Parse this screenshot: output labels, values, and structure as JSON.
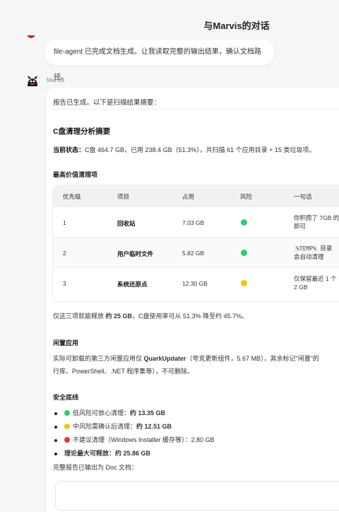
{
  "window": {
    "title": "与Marvis的对话"
  },
  "messages": {
    "first": "file-agent 已完成文档生成。让我读取完整的输出结果，确认文档路径。",
    "sender": "Marvis",
    "intro": "报告已生成。以下是扫描结果摘要："
  },
  "report": {
    "title": "C盘清理分析摘要",
    "status_label": "当前状态：",
    "status_text": "C盘 464.7 GB，已用 238.4 GB（51.3%），共扫描 61 个应用目录 + 15 类垃圾项。",
    "top_heading": "最高价值清理项",
    "table": {
      "headers": [
        "优先级",
        "项目",
        "占用",
        "风险",
        "一句话"
      ],
      "rows": [
        {
          "priority": "1",
          "item": "回收站",
          "size": "7.03 GB",
          "risk": "green",
          "line1": "你积攒了 7GB 的",
          "line2": "即可"
        },
        {
          "priority": "2",
          "item": "用户临时文件",
          "size": "5.82 GB",
          "risk": "green",
          "code": "%TEMP%",
          "line1_after": " 目录",
          "line2": "会自动清理"
        },
        {
          "priority": "3",
          "item": "系统还原点",
          "size": "12.30 GB",
          "risk": "yellow",
          "line1": "仅保留最近 1 个",
          "line2": "2 GB"
        }
      ]
    },
    "summary_pre": "仅这三项就能释放 ",
    "summary_bold": "约 25 GB",
    "summary_post": "，C盘使用率可从 51.3% 降至约 45.7%。",
    "idle_heading": "闲置应用",
    "idle_pre": "实际可卸载的第三方闲置应用仅 ",
    "idle_bold": "QuarkUpdater",
    "idle_post": "（夸克更新组件，5.67 MB），其余标记\"闲置\"的",
    "idle_line2": "行库、PowerShell、.NET 程序集等），不可删除。",
    "safety_heading": "安全底线",
    "bullets": [
      {
        "color": "green",
        "label": "低风险可放心清理：",
        "value": "约 13.35 GB"
      },
      {
        "color": "yellow",
        "label": "中风险需确认后清理：",
        "value": "约 12.51 GB"
      },
      {
        "color": "red",
        "label": "不建议清理（Windows Installer 缓存等）：2.80 GB",
        "value": ""
      },
      {
        "color": "",
        "label": "理论最大可释放：",
        "value": "约 25.86 GB"
      }
    ],
    "output_note": "完整报告已输出为 Doc 文档："
  },
  "colors": {
    "green": "#2ecc71",
    "yellow": "#f5c518",
    "red": "#e53935"
  }
}
